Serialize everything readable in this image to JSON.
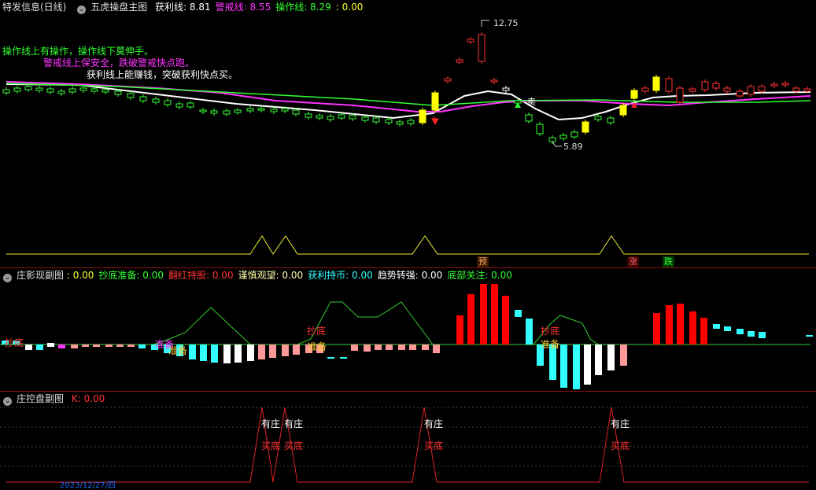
{
  "main_panel": {
    "title": "特发信息(日线)",
    "indicator_name": "五虎操盘主图",
    "values": [
      {
        "label": "获利线:",
        "value": "8.81",
        "color": "#ffffff"
      },
      {
        "label": "警戒线:",
        "value": "8.55",
        "color": "#ff33ff"
      },
      {
        "label": "操作线:",
        "value": "8.29",
        "color": "#33ff33"
      },
      {
        "label": ":",
        "value": "0.00",
        "color": "#ffff33"
      }
    ],
    "notes": [
      {
        "text": "操作线上有操作，操作线下莫伸手。",
        "color": "#33ff33"
      },
      {
        "text": "警戒线上保安全，跌破警戒快点跑。",
        "color": "#ff33ff"
      },
      {
        "text": "获利线上能赚钱，突破获利快点买。",
        "color": "#ffffff"
      }
    ],
    "high_label": "12.75",
    "low_label": "5.89",
    "sell_label": "卖",
    "signal_tags": [
      {
        "text": "预",
        "color": "#ffaa66"
      },
      {
        "text": "涨",
        "color": "#ff6666"
      },
      {
        "text": "跌",
        "color": "#33ff33"
      }
    ]
  },
  "mid_panel": {
    "title": "庄影现副图",
    "values": [
      {
        "label": ":",
        "value": "0.00",
        "color": "#ffff33"
      },
      {
        "label": "抄底准备:",
        "value": "0.00",
        "color": "#33ff33"
      },
      {
        "label": "翻红持股:",
        "value": "0.00",
        "color": "#ff3333"
      },
      {
        "label": "谨慎观望:",
        "value": "0.00",
        "color": "#ffffaa"
      },
      {
        "label": "获利持币:",
        "value": "0.00",
        "color": "#33ffff"
      },
      {
        "label": "趋势转强:",
        "value": "0.00",
        "color": "#ffffff"
      },
      {
        "label": "底部关注:",
        "value": "0.00",
        "color": "#33ff33"
      }
    ],
    "labels": {
      "chaodi": "抄底",
      "ready": "准备"
    }
  },
  "bottom_panel": {
    "title": "庄控盘副图",
    "values": [
      {
        "label": "K:",
        "value": "0.00",
        "color": "#ff3333"
      }
    ],
    "labels": {
      "youzhuang": "有庄",
      "maidi": "买底"
    }
  },
  "date_strip": {
    "text": "2023/12/27/四"
  }
}
